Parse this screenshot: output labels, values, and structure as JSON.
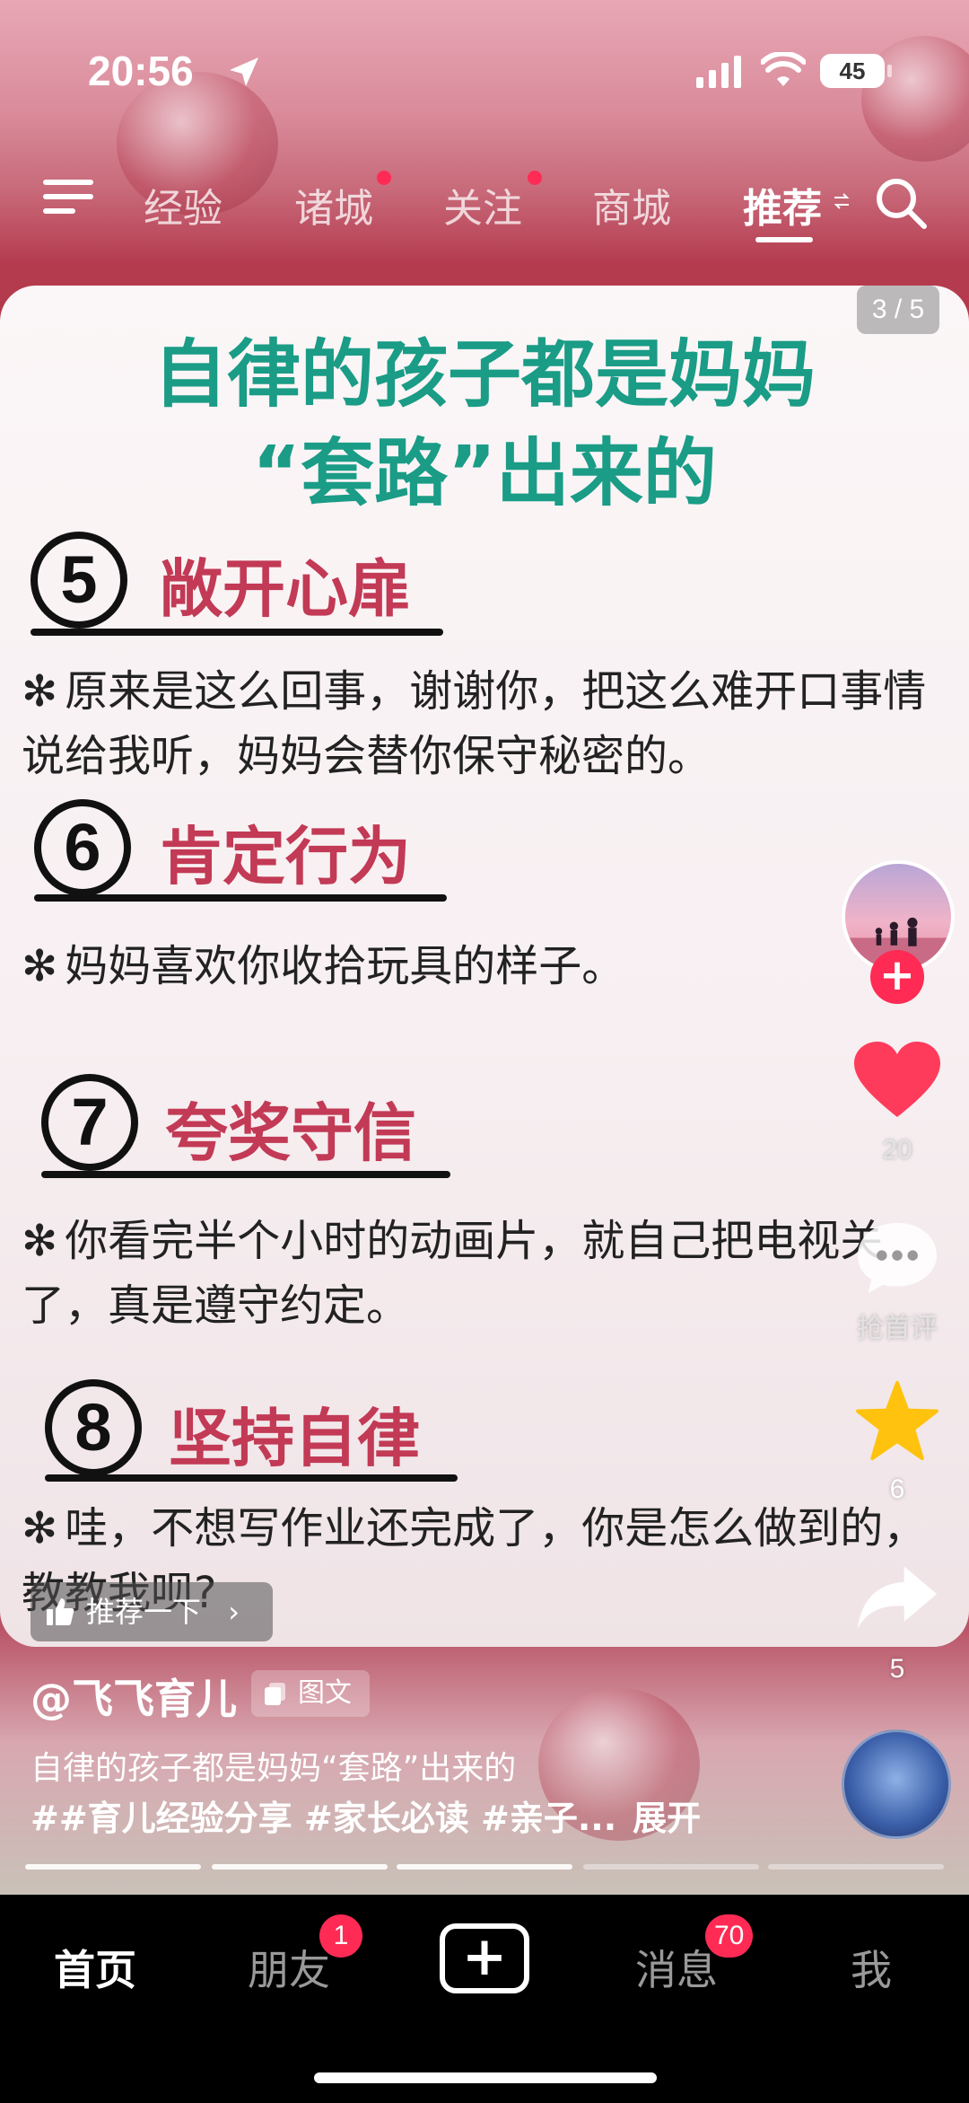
{
  "status_bar": {
    "time": "20:56",
    "battery": "45"
  },
  "top_nav": {
    "tabs": [
      {
        "label": "经验"
      },
      {
        "label": "诸城"
      },
      {
        "label": "关注"
      },
      {
        "label": "商城"
      },
      {
        "label": "推荐"
      }
    ],
    "active_tab": "推荐"
  },
  "post": {
    "page_counter": "3 / 5",
    "title_line1": "自律的孩子都是妈妈",
    "title_line2": "“套路”出来的",
    "sections": [
      {
        "num": "5",
        "title": "敞开心扉",
        "text": "原来是这么回事，谢谢你，把这么难开口事情说给我听，妈妈会替你保守秘密的。"
      },
      {
        "num": "6",
        "title": "肯定行为",
        "text": "妈妈喜欢你收拾玩具的样子。"
      },
      {
        "num": "7",
        "title": "夸奖守信",
        "text": "你看完半个小时的动画片，就自己把电视关了，真是遵守约定。"
      },
      {
        "num": "8",
        "title": "坚持自律",
        "text": "哇，不想写作业还完成了，你是怎么做到的，教教我呗?"
      }
    ],
    "bullet": "✻"
  },
  "actions": {
    "follow": "+",
    "likes": "20",
    "comments": "抢首评",
    "favorites": "6",
    "shares": "5"
  },
  "recommend_label": "推荐一下",
  "author": "@飞飞育儿",
  "content_type_badge": "图文",
  "caption_line1": "自律的孩子都是妈妈“套路”出来的",
  "caption_line2": "##育儿经验分享 #家长必读 #亲子...",
  "expand_label": "展开",
  "image_progress": {
    "current": 3,
    "total": 5
  },
  "bottom_nav": {
    "home": "首页",
    "friends": "朋友",
    "friends_badge": "1",
    "create": "+",
    "messages": "消息",
    "messages_badge": "70",
    "me": "我"
  },
  "colors": {
    "title_green": "#1a9c86",
    "section_red": "#c23a55",
    "like_red": "#ff3b5c",
    "star_yellow": "#ffc20e",
    "badge_red": "#ff2b54"
  }
}
